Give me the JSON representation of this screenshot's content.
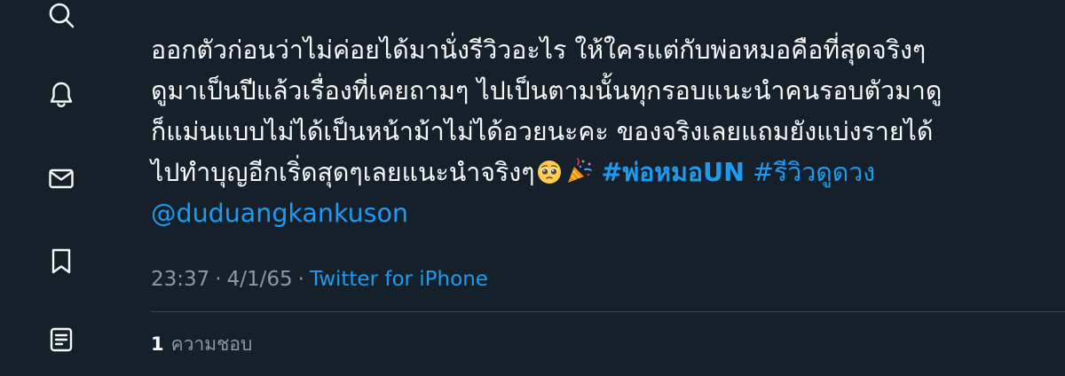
{
  "colors": {
    "background": "#15202b",
    "text": "#f7f9f9",
    "secondary_text": "#8b98a5",
    "link": "#1d9bf0",
    "divider": "#38444d"
  },
  "sidebar": {
    "icons": [
      "search-icon",
      "notifications-bell-icon",
      "messages-envelope-icon",
      "bookmark-icon",
      "lists-document-icon"
    ]
  },
  "tweet": {
    "lines": [
      "ออกตัวก่อนว่าไม่ค่อยได้มานั่งรีวิวอะไร ให้ใครแต่กับพ่อหมอคือที่สุดจริงๆ",
      "ดูมาเป็นปีแล้วเรื่องที่เคยถามๆ ไปเป็นตามนั้นทุกรอบแนะนำคนรอบตัวมาดู",
      "ก็แม่นแบบไม่ได้เป็นหน้าม้าไม่ได้อวยนะคะ ของจริงเลยแถมยังแบ่งรายได้"
    ],
    "line4_text": "ไปทำบุญอีกเริ่ดสุดๆเลยแนะนำจริงๆ",
    "emojis": [
      "pleading-face",
      "party-popper"
    ],
    "hashtag_1": "#พ่อหมอUN",
    "hashtag_2": "#รีวิวดูดวง",
    "mention": "@duduangkankuson"
  },
  "meta": {
    "time": "23:37",
    "separator_1": "·",
    "date": "4/1/65",
    "separator_2": "·",
    "source": "Twitter for iPhone"
  },
  "likes": {
    "count": "1",
    "label": "ความชอบ"
  }
}
